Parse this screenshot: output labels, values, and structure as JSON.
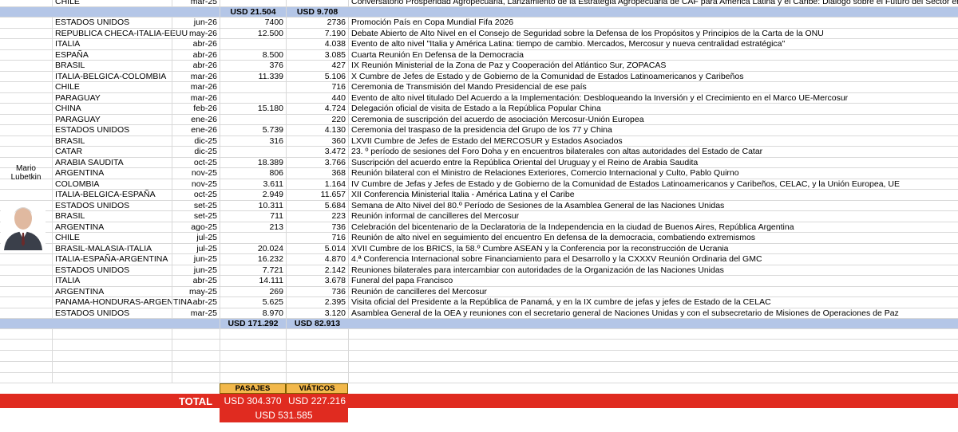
{
  "top_row": {
    "country": "CHILE",
    "date": "mar-25",
    "description": "Conversatorio Prosperidad Agropecuaria, Lanzamiento de la Estrategia Agropecuaria de CAF para América Latina y el Caribe: Diálogo sobre el Futuro del Sector en la Región y el Mundo"
  },
  "subtotal_1": {
    "pasajes": "USD 21.504",
    "viaticos": "USD 9.708"
  },
  "person": {
    "name": "Mario Lubetkin"
  },
  "rows": [
    {
      "country": "ESTADOS UNIDOS",
      "date": "jun-26",
      "pasajes": "7400",
      "viaticos": "2736",
      "description": "Promoción País en Copa Mundial Fifa 2026"
    },
    {
      "country": "REPUBLICA CHECA-ITALIA-EEUU",
      "date": "may-26",
      "pasajes": "12.500",
      "viaticos": "7.190",
      "description": "Debate Abierto de Alto Nivel en el Consejo de Seguridad sobre la Defensa de los Propósitos y Principios de la Carta de la ONU"
    },
    {
      "country": "ITALIA",
      "date": "abr-26",
      "pasajes": "",
      "viaticos": "4.038",
      "description": "Evento de alto nivel \"Italia y América Latina: tiempo de cambio. Mercados, Mercosur y nueva centralidad estratégica\""
    },
    {
      "country": "ESPAÑA",
      "date": "abr-26",
      "pasajes": "8.500",
      "viaticos": "3.085",
      "description": "Cuarta Reunión En Defensa de la Democracia"
    },
    {
      "country": "BRASIL",
      "date": "abr-26",
      "pasajes": "376",
      "viaticos": "427",
      "description": "IX Reunión Ministerial de la Zona de Paz y Cooperación del Atlántico Sur, ZOPACAS"
    },
    {
      "country": "ITALIA-BELGICA-COLOMBIA",
      "date": "mar-26",
      "pasajes": "11.339",
      "viaticos": "5.106",
      "description": "X Cumbre de Jefes de Estado y de Gobierno de la Comunidad de Estados Latinoamericanos y Caribeños"
    },
    {
      "country": "CHILE",
      "date": "mar-26",
      "pasajes": "",
      "viaticos": "716",
      "description": "Ceremonia de Transmisión del Mando Presidencial de ese país"
    },
    {
      "country": "PARAGUAY",
      "date": "mar-26",
      "pasajes": "",
      "viaticos": "440",
      "description": "Evento de alto nivel titulado Del Acuerdo a la Implementación: Desbloqueando la Inversión y el Crecimiento en el Marco UE-Mercosur"
    },
    {
      "country": "CHINA",
      "date": "feb-26",
      "pasajes": "15.180",
      "viaticos": "4.724",
      "description": "Delegación oficial de visita de Estado a la República Popular China"
    },
    {
      "country": "PARAGUAY",
      "date": "ene-26",
      "pasajes": "",
      "viaticos": "220",
      "description": "Ceremonia de suscripción del acuerdo de asociación Mercosur-Unión Europea"
    },
    {
      "country": "ESTADOS UNIDOS",
      "date": "ene-26",
      "pasajes": "5.739",
      "viaticos": "4.130",
      "description": "Ceremonia del traspaso de la presidencia del Grupo de los 77 y China"
    },
    {
      "country": "BRASIL",
      "date": "dic-25",
      "pasajes": "316",
      "viaticos": "360",
      "description": "LXVII Cumbre de Jefes de Estado del MERCOSUR y Estados Asociados"
    },
    {
      "country": "CATAR",
      "date": "dic-25",
      "pasajes": "",
      "viaticos": "3.472",
      "description": "23. º período de sesiones del Foro Doha y en encuentros bilaterales con altas autoridades del Estado de Catar"
    },
    {
      "country": "ARABIA SAUDITA",
      "date": "oct-25",
      "pasajes": "18.389",
      "viaticos": "3.766",
      "description": "Suscripción del acuerdo entre la República Oriental del Uruguay y el Reino de Arabia Saudita"
    },
    {
      "country": "ARGENTINA",
      "date": "nov-25",
      "pasajes": "806",
      "viaticos": "368",
      "description": "Reunión bilateral con el Ministro de Relaciones Exteriores, Comercio Internacional y Culto, Pablo Quirno"
    },
    {
      "country": "COLOMBIA",
      "date": "nov-25",
      "pasajes": "3.611",
      "viaticos": "1.164",
      "description": "IV Cumbre de Jefas y Jefes de Estado y de Gobierno de la Comunidad de Estados Latinoamericanos y Caribeños, CELAC, y la Unión Europea, UE"
    },
    {
      "country": "ITALIA-BELGICA-ESPAÑA",
      "date": "oct-25",
      "pasajes": "2.949",
      "viaticos": "11.657",
      "description": "XII Conferencia Ministerial Italia - América Latina y el Caribe"
    },
    {
      "country": "ESTADOS UNIDOS",
      "date": "set-25",
      "pasajes": "10.311",
      "viaticos": "5.684",
      "description": "Semana de Alto Nivel del 80.º Período de Sesiones de la Asamblea General de las Naciones Unidas"
    },
    {
      "country": "BRASIL",
      "date": "set-25",
      "pasajes": "711",
      "viaticos": "223",
      "description": "Reunión informal de cancilleres del Mercosur"
    },
    {
      "country": "ARGENTINA",
      "date": "ago-25",
      "pasajes": "213",
      "viaticos": "736",
      "description": "Celebración del bicentenario de la Declaratoria de la Independencia en la ciudad de Buenos Aires, República Argentina"
    },
    {
      "country": "CHILE",
      "date": "jul-25",
      "pasajes": "",
      "viaticos": "716",
      "description": "Reunión de alto nivel en seguimiento del encuentro En defensa de la democracia, combatiendo extremismos"
    },
    {
      "country": "BRASIL-MALASIA-ITALIA",
      "date": "jul-25",
      "pasajes": "20.024",
      "viaticos": "5.014",
      "description": "XVII Cumbre de los BRICS, la 58.º Cumbre ASEAN y la Conferencia por la reconstrucción de Ucrania"
    },
    {
      "country": "ITALIA-ESPAÑA-ARGENTINA",
      "date": "jun-25",
      "pasajes": "16.232",
      "viaticos": "4.870",
      "description": "4.ª Conferencia Internacional sobre Financiamiento para el Desarrollo y la CXXXV Reunión Ordinaria del GMC"
    },
    {
      "country": "ESTADOS UNIDOS",
      "date": "jun-25",
      "pasajes": "7.721",
      "viaticos": "2.142",
      "description": "Reuniones bilaterales para intercambiar con autoridades de la Organización de las Naciones Unidas"
    },
    {
      "country": "ITALIA",
      "date": "abr-25",
      "pasajes": "14.111",
      "viaticos": "3.678",
      "description": "Funeral del papa Francisco"
    },
    {
      "country": "ARGENTINA",
      "date": "may-25",
      "pasajes": "269",
      "viaticos": "736",
      "description": "Reunión de cancilleres del Mercosur"
    },
    {
      "country": "PANAMA-HONDURAS-ARGENTINA",
      "date": "abr-25",
      "pasajes": "5.625",
      "viaticos": "2.395",
      "description": "Visita oficial del Presidente a la República de Panamá, y en la IX cumbre de jefas y jefes de Estado de la CELAC"
    },
    {
      "country": "ESTADOS UNIDOS",
      "date": "mar-25",
      "pasajes": "8.970",
      "viaticos": "3.120",
      "description": "Asamblea General de la OEA y reuniones con el secretario general de Naciones Unidas y con el subsecretario de Misiones de Operaciones de Paz"
    }
  ],
  "subtotal_2": {
    "pasajes": "USD 171.292",
    "viaticos": "USD 82.913"
  },
  "summary": {
    "pasajes_header": "PASAJES",
    "viaticos_header": "VIÁTICOS",
    "total_label": "TOTAL",
    "total_pasajes": "USD 304.370",
    "total_viaticos": "USD 227.216",
    "grand_total": "USD 531.585"
  },
  "colors": {
    "subtotal_band": "#b4c6e7",
    "header_band": "#f2b84b",
    "total_band": "#e02b20"
  }
}
